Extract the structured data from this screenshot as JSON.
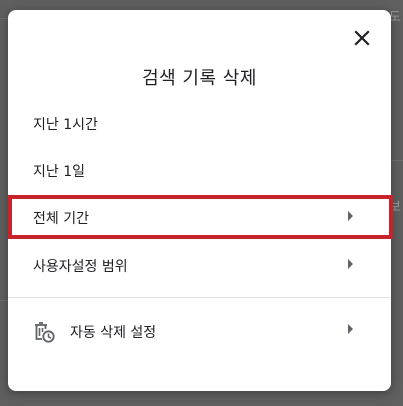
{
  "dialog": {
    "title": "검색 기록 삭제",
    "close_icon": "close-icon",
    "items": [
      {
        "label": "지난 1시간",
        "has_arrow": false
      },
      {
        "label": "지난 1일",
        "has_arrow": false
      },
      {
        "label": "전체 기간",
        "has_arrow": true,
        "highlighted": true
      },
      {
        "label": "사용자설정 범위",
        "has_arrow": true
      }
    ],
    "auto_delete": {
      "label": "자동 삭제 설정",
      "icon": "auto-delete-icon",
      "has_arrow": true
    }
  },
  "background": {
    "fragments": [
      "도",
      "보"
    ]
  },
  "colors": {
    "highlight_border": "#c8232a",
    "overlay": "#5f5f5f",
    "dialog_bg": "#ffffff",
    "text": "#202124",
    "icon": "#5f6368"
  }
}
